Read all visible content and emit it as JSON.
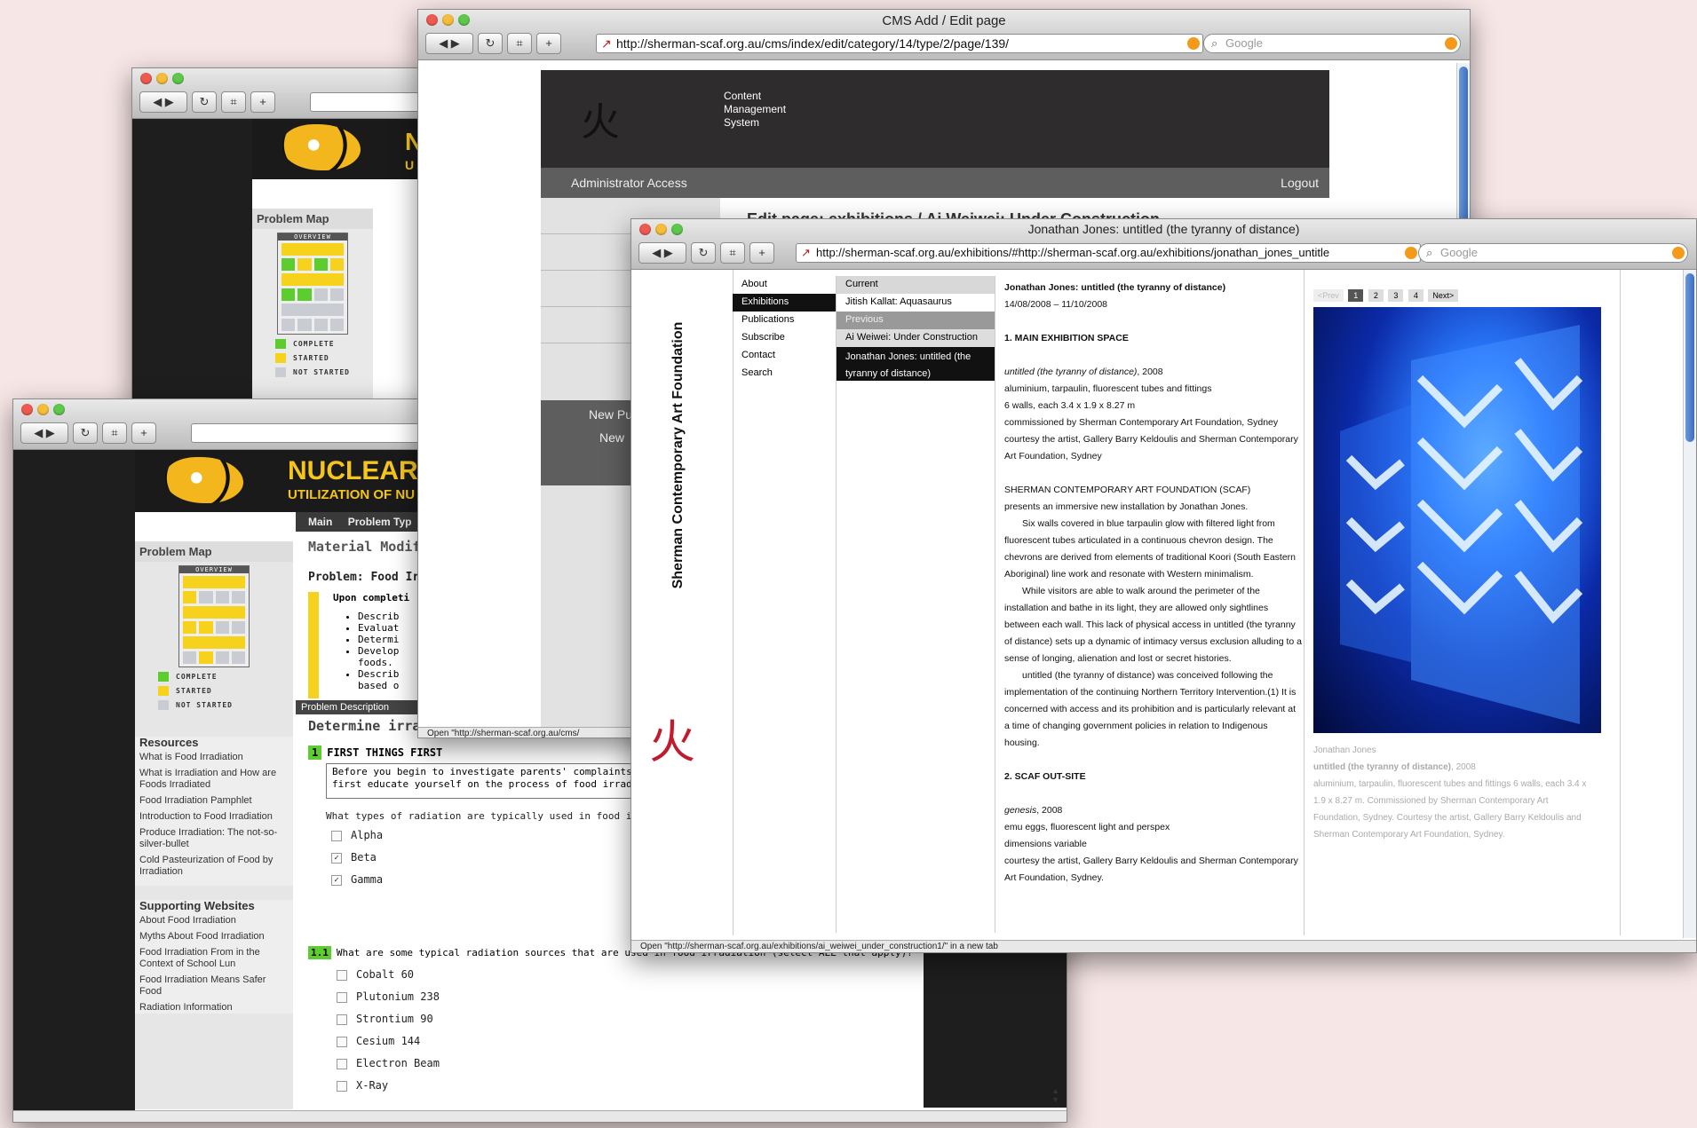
{
  "nuclear_back": {
    "problem_map": "Problem Map",
    "overview": "OVERVIEW",
    "legend": [
      "COMPLETE",
      "STARTED",
      "NOT STARTED"
    ],
    "title_partial": "N",
    "subtitle_partial": "U"
  },
  "nuclear_front": {
    "title": "NUCLEAR",
    "subtitle": "UTILIZATION OF NU",
    "problem_map": "Problem Map",
    "overview": "OVERVIEW",
    "legend": [
      "COMPLETE",
      "STARTED",
      "NOT STARTED"
    ],
    "tabs": [
      "Main",
      "Problem Typ"
    ],
    "heading": "Material Modifica",
    "problem": "Problem: Food Irra",
    "upon": "Upon completi",
    "bullets": [
      "Describ",
      "Evaluat",
      "Determi",
      "Develop",
      "foods.",
      "Describ",
      "based o"
    ],
    "problem_desc_tab": "Problem Description",
    "determine": "Determine irradiation process",
    "step1_num": "1",
    "step1_title": "FIRST THINGS FIRST",
    "step1_text1": "Before you begin to investigate parents' complaints",
    "step1_text2": "first educate yourself on the process of food irradiati",
    "q1": "What types of radiation are typically used in food irra",
    "q1_options": [
      {
        "label": "Alpha",
        "mark": ""
      },
      {
        "label": "Beta",
        "mark": "✓"
      },
      {
        "label": "Gamma",
        "mark": "✓"
      }
    ],
    "step11_num": "1.1",
    "q2": "What are some typical radiation sources that are used in food irradiation (select ALL that apply)?",
    "q2_options": [
      "Cobalt 60",
      "Plutonium 238",
      "Strontium 90",
      "Cesium 144",
      "Electron Beam",
      "X-Ray"
    ],
    "resources_title": "Resources",
    "resources": [
      "What is Food Irradiation",
      "What is Irradiation and How are Foods Irradiated",
      "Food Irradiation Pamphlet",
      "Introduction to Food Irradiation",
      "Produce Irradiation: The not-so-silver-bullet",
      "Cold Pasteurization of Food by Irradiation"
    ],
    "supporting_title": "Supporting Websites",
    "supporting": [
      "About Food Irradiation",
      "Myths About Food Irradiation",
      "Food Irradiation From in the Context of School Lun",
      "Food Irradiation Means Safer Food",
      "Radiation Information"
    ]
  },
  "cms": {
    "window_title": "CMS Add / Edit page",
    "url": "http://sherman-scaf.org.au/cms/index/edit/category/14/type/2/page/139/",
    "search_placeholder": "Google",
    "header_text": [
      "Content",
      "Management",
      "System"
    ],
    "admin": "Administrator Access",
    "logout": "Logout",
    "edit_title": "Edit page: exhibitions / Ai Weiwei: Under Construction",
    "new_items": [
      "New Pu",
      "New"
    ],
    "status": "Open \"http://sherman-scaf.org.au/cms/"
  },
  "scaf": {
    "window_title": "Jonathan Jones: untitled (the tyranny of distance)",
    "url": "http://sherman-scaf.org.au/exhibitions/#http://sherman-scaf.org.au/exhibitions/jonathan_jones_untitle",
    "search_placeholder": "Google",
    "brand": "Sherman Contemporary Art Foundation",
    "nav": [
      "About",
      "Exhibitions",
      "Publications",
      "Subscribe",
      "Contact",
      "Search"
    ],
    "current_label": "Current",
    "current_item": "Jitish Kallat: Aquasaurus",
    "previous_label": "Previous",
    "previous_items": [
      "Ai Weiwei: Under Construction",
      "Jonathan Jones: untitled (the tyranny of distance)"
    ],
    "article_title": "Jonathan Jones: untitled (the tyranny of distance)",
    "dates": "14/08/2008 – 11/10/2008",
    "sec1": "1. MAIN EXHIBITION SPACE",
    "work1_title": "untitled (the tyranny of distance)",
    "work1_year": ", 2008",
    "work1_lines": [
      "aluminium, tarpaulin, fluorescent tubes and fittings",
      "6 walls, each 3.4 x 1.9 x 8.27 m",
      "commissioned by Sherman Contemporary Art Foundation, Sydney",
      "courtesy the artist, Gallery Barry Keldoulis and Sherman Contemporary Art Foundation, Sydney"
    ],
    "para_lines": [
      "SHERMAN CONTEMPORARY ART FOUNDATION (SCAF)",
      "presents an immersive new installation by Jonathan Jones.",
      "Six walls covered in blue tarpaulin glow with filtered light from fluorescent tubes articulated in a continuous chevron design. The chevrons are derived from elements of traditional Koori (South Eastern Aboriginal) line work and resonate with Western minimalism.",
      "While visitors are able to walk around the perimeter of the installation and bathe in its light, they are allowed only sightlines between each wall. This lack of physical access in untitled (the tyranny of distance) sets up a dynamic of intimacy versus exclusion alluding to a sense of longing, alienation and lost or secret histories.",
      "untitled (the tyranny of distance) was conceived following the implementation of the continuing Northern Territory Intervention.(1) It is concerned with access and its prohibition and is particularly relevant at a time of changing government policies in relation to Indigenous housing."
    ],
    "sec2": "2. SCAF OUT-SITE",
    "work2_title": "genesis",
    "work2_year": ", 2008",
    "work2_lines": [
      "emu eggs, fluorescent light and perspex",
      "dimensions variable",
      "courtesy the artist, Gallery Barry Keldoulis and Sherman Contemporary Art Foundation, Sydney."
    ],
    "pager": [
      "<Prev",
      "1",
      "2",
      "3",
      "4",
      "Next>"
    ],
    "cap_artist": "Jonathan Jones",
    "cap_title": "untitled (the tyranny of distance)",
    "cap_year": ", 2008",
    "cap_text": "aluminium, tarpaulin, fluorescent tubes and fittings 6 walls, each 3.4 x 1.9 x 8.27 m. Commissioned by Sherman Contemporary Art Foundation, Sydney. Courtesy the artist, Gallery Barry Keldoulis and Sherman Contemporary Art Foundation, Sydney.",
    "status": "Open \"http://sherman-scaf.org.au/exhibitions/ai_weiwei_under_construction1/\" in a new tab"
  },
  "colors": {
    "yellow": "#f6d21c",
    "green": "#5dcc2e",
    "grey": "#c9ccd2",
    "dark": "#2e2c2c",
    "blue": "#1a4fd6"
  }
}
